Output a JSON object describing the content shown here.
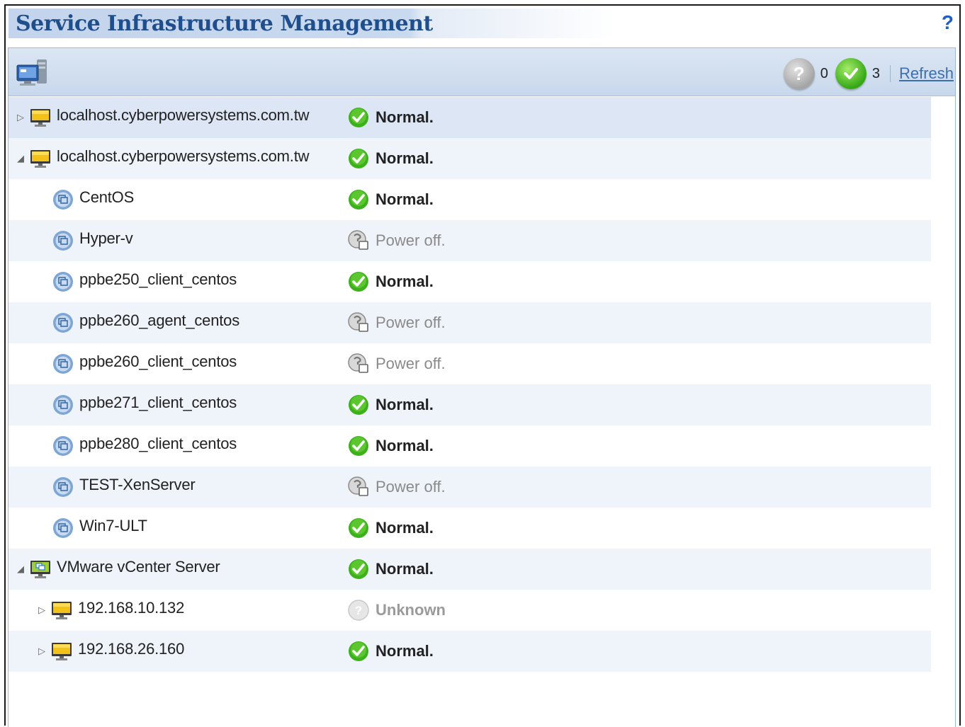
{
  "header": {
    "title": "Service Infrastructure Management",
    "help": "?"
  },
  "toolbar": {
    "server_icon": "server-icon",
    "unknown_icon": "?",
    "unknown_count": "0",
    "normal_count": "3",
    "refresh_label": "Refresh"
  },
  "rows": [
    {
      "name": "localhost.cyberpowersystems.com.tw",
      "status": "Normal.",
      "status_type": "normal",
      "icon": "monitor-icon",
      "expander": "▷",
      "level": 0
    },
    {
      "name": "localhost.cyberpowersystems.com.tw",
      "status": "Normal.",
      "status_type": "normal",
      "icon": "monitor-icon",
      "expander": "◢",
      "level": 0
    },
    {
      "name": "CentOS",
      "status": "Normal.",
      "status_type": "normal",
      "icon": "vm-icon",
      "level": 1
    },
    {
      "name": "Hyper-v",
      "status": "Power off.",
      "status_type": "off",
      "icon": "vm-icon",
      "level": 1
    },
    {
      "name": "ppbe250_client_centos",
      "status": "Normal.",
      "status_type": "normal",
      "icon": "vm-icon",
      "level": 1
    },
    {
      "name": "ppbe260_agent_centos",
      "status": "Power off.",
      "status_type": "off",
      "icon": "vm-icon",
      "level": 1
    },
    {
      "name": "ppbe260_client_centos",
      "status": "Power off.",
      "status_type": "off",
      "icon": "vm-icon",
      "level": 1
    },
    {
      "name": "ppbe271_client_centos",
      "status": "Normal.",
      "status_type": "normal",
      "icon": "vm-icon",
      "level": 1
    },
    {
      "name": "ppbe280_client_centos",
      "status": "Normal.",
      "status_type": "normal",
      "icon": "vm-icon",
      "level": 1
    },
    {
      "name": "TEST-XenServer",
      "status": "Power off.",
      "status_type": "off",
      "icon": "vm-icon",
      "level": 1
    },
    {
      "name": "Win7-ULT",
      "status": "Normal.",
      "status_type": "normal",
      "icon": "vm-icon",
      "level": 1
    },
    {
      "name": "VMware vCenter Server",
      "status": "Normal.",
      "status_type": "normal",
      "icon": "vcenter-icon",
      "expander": "◢",
      "level": 0
    },
    {
      "name": "192.168.10.132",
      "status": "Unknown",
      "status_type": "unknown",
      "icon": "monitor-icon",
      "expander": "▷",
      "level": 1
    },
    {
      "name": "192.168.26.160",
      "status": "Normal.",
      "status_type": "normal",
      "icon": "monitor-icon",
      "expander": "▷",
      "level": 1
    }
  ]
}
